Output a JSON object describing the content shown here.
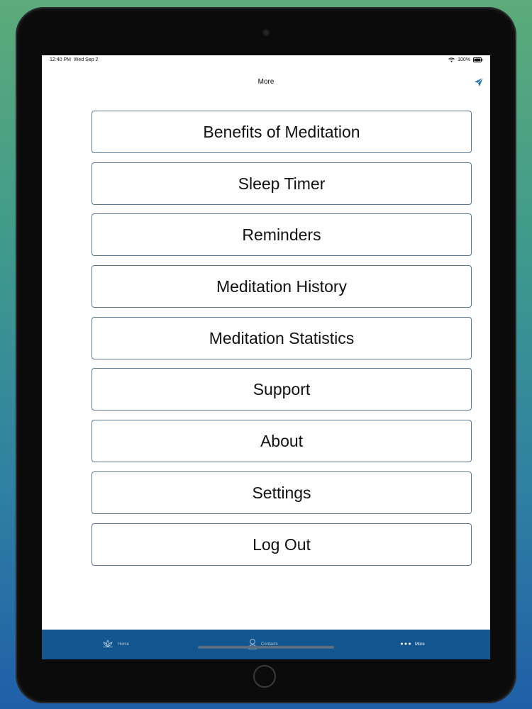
{
  "status_bar": {
    "time": "12:40 PM",
    "date": "Wed Sep 2",
    "battery": "100%"
  },
  "nav": {
    "title": "More",
    "action_icon": "send-icon"
  },
  "menu": [
    {
      "label": "Benefits of Meditation"
    },
    {
      "label": "Sleep Timer"
    },
    {
      "label": "Reminders"
    },
    {
      "label": "Meditation History"
    },
    {
      "label": "Meditation Statistics"
    },
    {
      "label": "Support"
    },
    {
      "label": "About"
    },
    {
      "label": "Settings"
    },
    {
      "label": "Log Out"
    }
  ],
  "tabs": [
    {
      "label": "Home",
      "icon": "lotus-icon",
      "active": false
    },
    {
      "label": "Contacts",
      "icon": "person-icon",
      "active": false
    },
    {
      "label": "More",
      "icon": "more-dots-icon",
      "active": true
    }
  ],
  "colors": {
    "accent": "#13568f",
    "button_border": "#5b7894"
  }
}
